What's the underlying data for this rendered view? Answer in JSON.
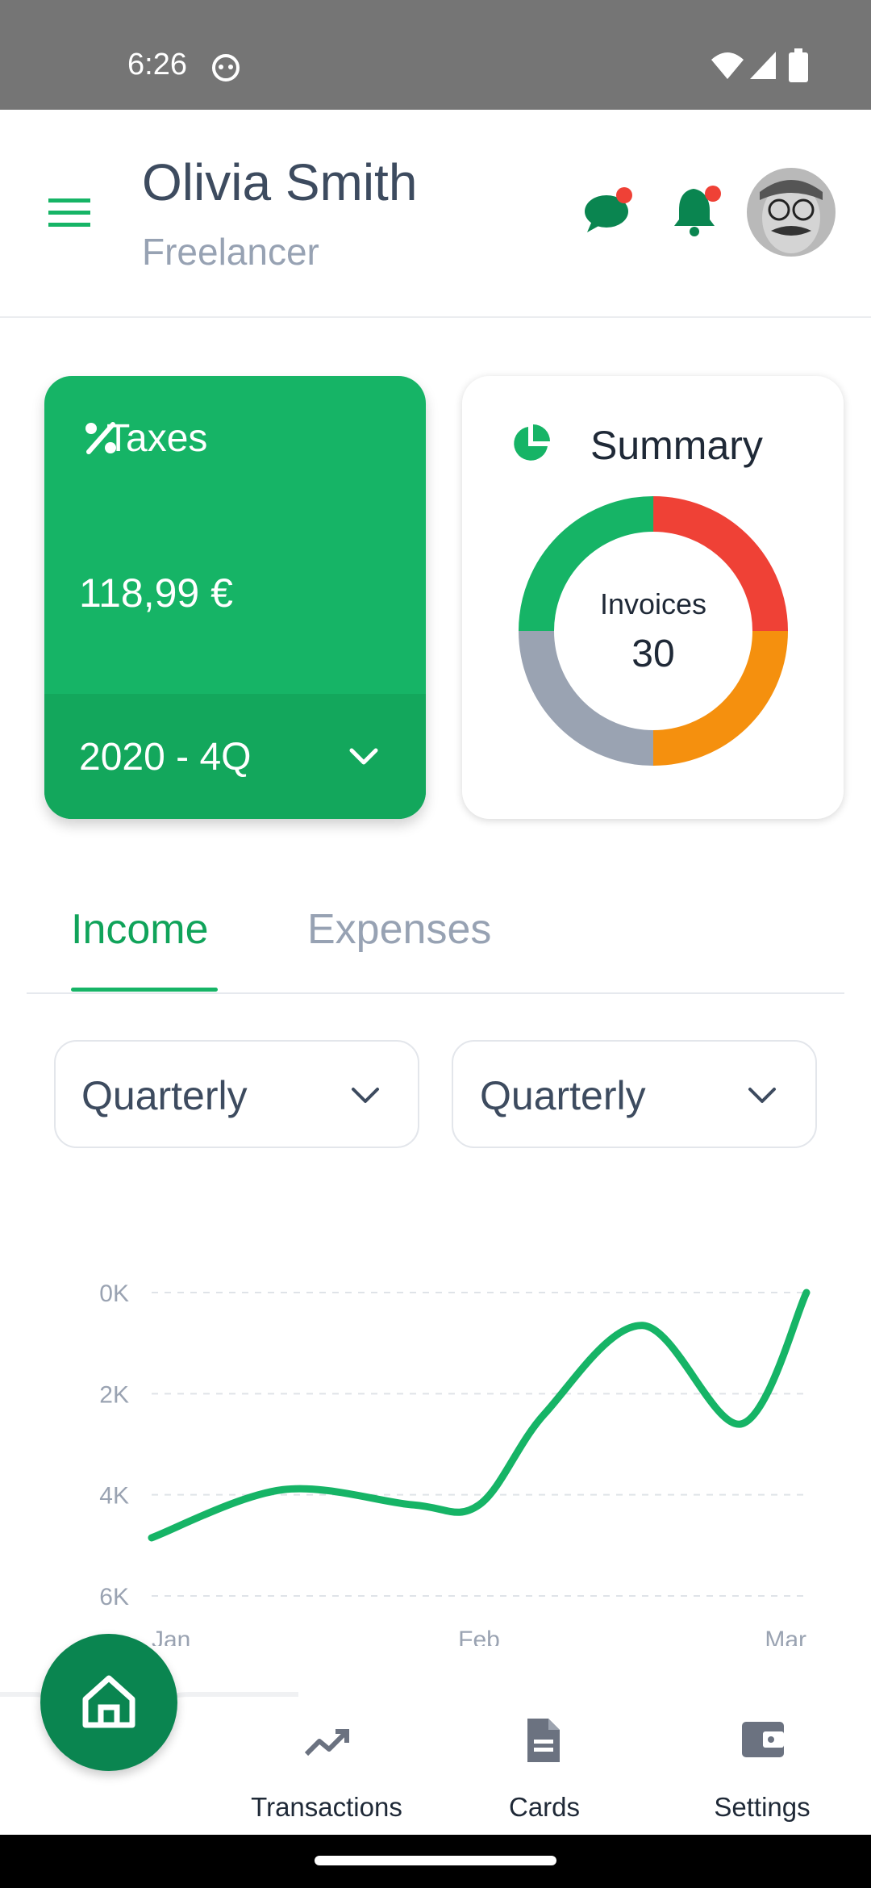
{
  "status_bar": {
    "time": "6:26"
  },
  "header": {
    "user_name": "Olivia Smith",
    "user_role": "Freelancer"
  },
  "taxes_card": {
    "title": "Taxes",
    "amount": "118,99 €",
    "period": "2020 - 4Q"
  },
  "summary_card": {
    "title": "Summary",
    "donut_label": "Invoices",
    "donut_value": "30"
  },
  "tabs": [
    {
      "label": "Income",
      "active": true
    },
    {
      "label": "Expenses",
      "active": false
    }
  ],
  "filters": {
    "left": "Quarterly",
    "right": "Quarterly"
  },
  "nav": {
    "transactions": "Transactions",
    "cards": "Cards",
    "settings": "Settings"
  },
  "colors": {
    "accent": "#16b466",
    "accent_dark": "#0a8550",
    "badge": "#ef4136",
    "donut_green": "#16b466",
    "donut_red": "#ef4136",
    "donut_orange": "#f5900e",
    "donut_gray": "#9aa3b2"
  },
  "chart_data": {
    "type": "line",
    "x": [
      "Jan",
      "Feb",
      "Mar"
    ],
    "yticks": [
      "0K",
      "2K",
      "4K",
      "6K"
    ],
    "ylim": [
      0,
      6000
    ],
    "y_inverted": true,
    "grid": true,
    "series": [
      {
        "points": [
          [
            0.0,
            4850
          ],
          [
            0.2,
            3900
          ],
          [
            0.4,
            4200
          ],
          [
            0.5,
            4200
          ],
          [
            0.6,
            2400
          ],
          [
            0.75,
            650
          ],
          [
            0.9,
            2600
          ],
          [
            1.0,
            0
          ]
        ]
      }
    ]
  }
}
